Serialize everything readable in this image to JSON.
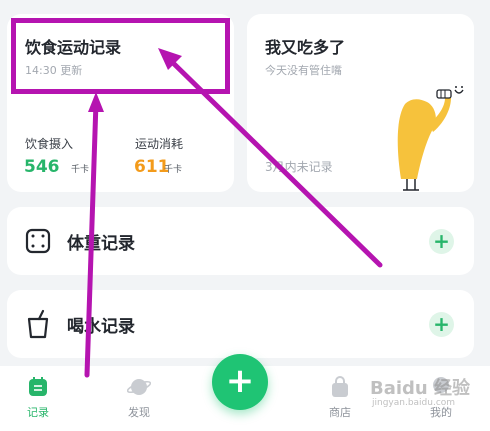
{
  "diet_card": {
    "title": "饮食运动记录",
    "time": "14:30 更新",
    "intake_label": "饮食摄入",
    "intake_value": "546",
    "intake_unit": "千卡",
    "burn_label": "运动消耗",
    "burn_value": "611",
    "burn_unit": "千卡"
  },
  "ate_card": {
    "title": "我又吃多了",
    "subtitle": "今天没有管住嘴",
    "status": "3月内未记录"
  },
  "weight_row": {
    "label": "体重记录",
    "add": "+"
  },
  "water_row": {
    "label": "喝水记录",
    "add": "+"
  },
  "fab": {
    "label": "+"
  },
  "nav": {
    "items": [
      {
        "label": "记录"
      },
      {
        "label": "发现"
      },
      {
        "label": "商店"
      },
      {
        "label": "我的"
      }
    ]
  },
  "watermark": {
    "brand": "Baidu 经验",
    "url": "jingyan.baidu.com"
  },
  "colors": {
    "accent_green": "#27b56a",
    "accent_orange": "#f39b1b",
    "highlight_magenta": "#b514b0",
    "background": "#f2f4f6"
  }
}
